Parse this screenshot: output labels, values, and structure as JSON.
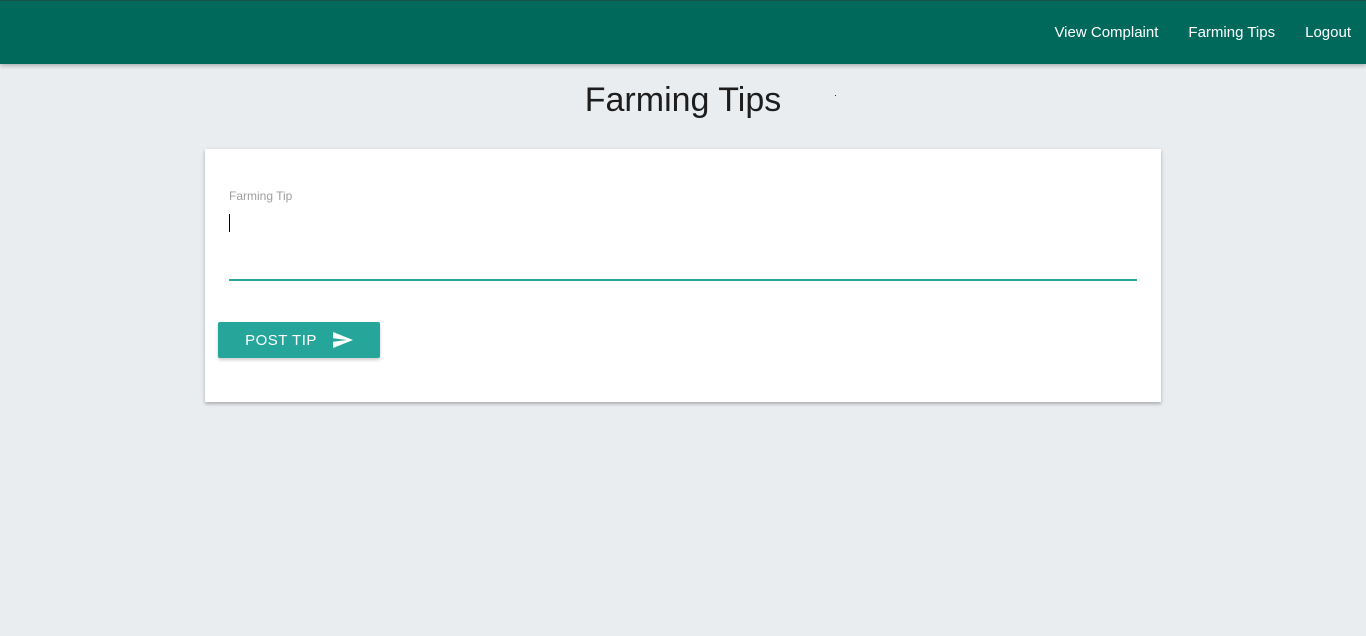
{
  "navbar": {
    "links": [
      {
        "label": "View Complaint"
      },
      {
        "label": "Farming Tips"
      },
      {
        "label": "Logout"
      }
    ],
    "color": "#00695c"
  },
  "page": {
    "title": "Farming Tips"
  },
  "form": {
    "field_label": "Farming Tip",
    "field_value": "",
    "submit_label": "POST TIP",
    "submit_icon": "send-icon",
    "accent_color": "#26a69a"
  }
}
